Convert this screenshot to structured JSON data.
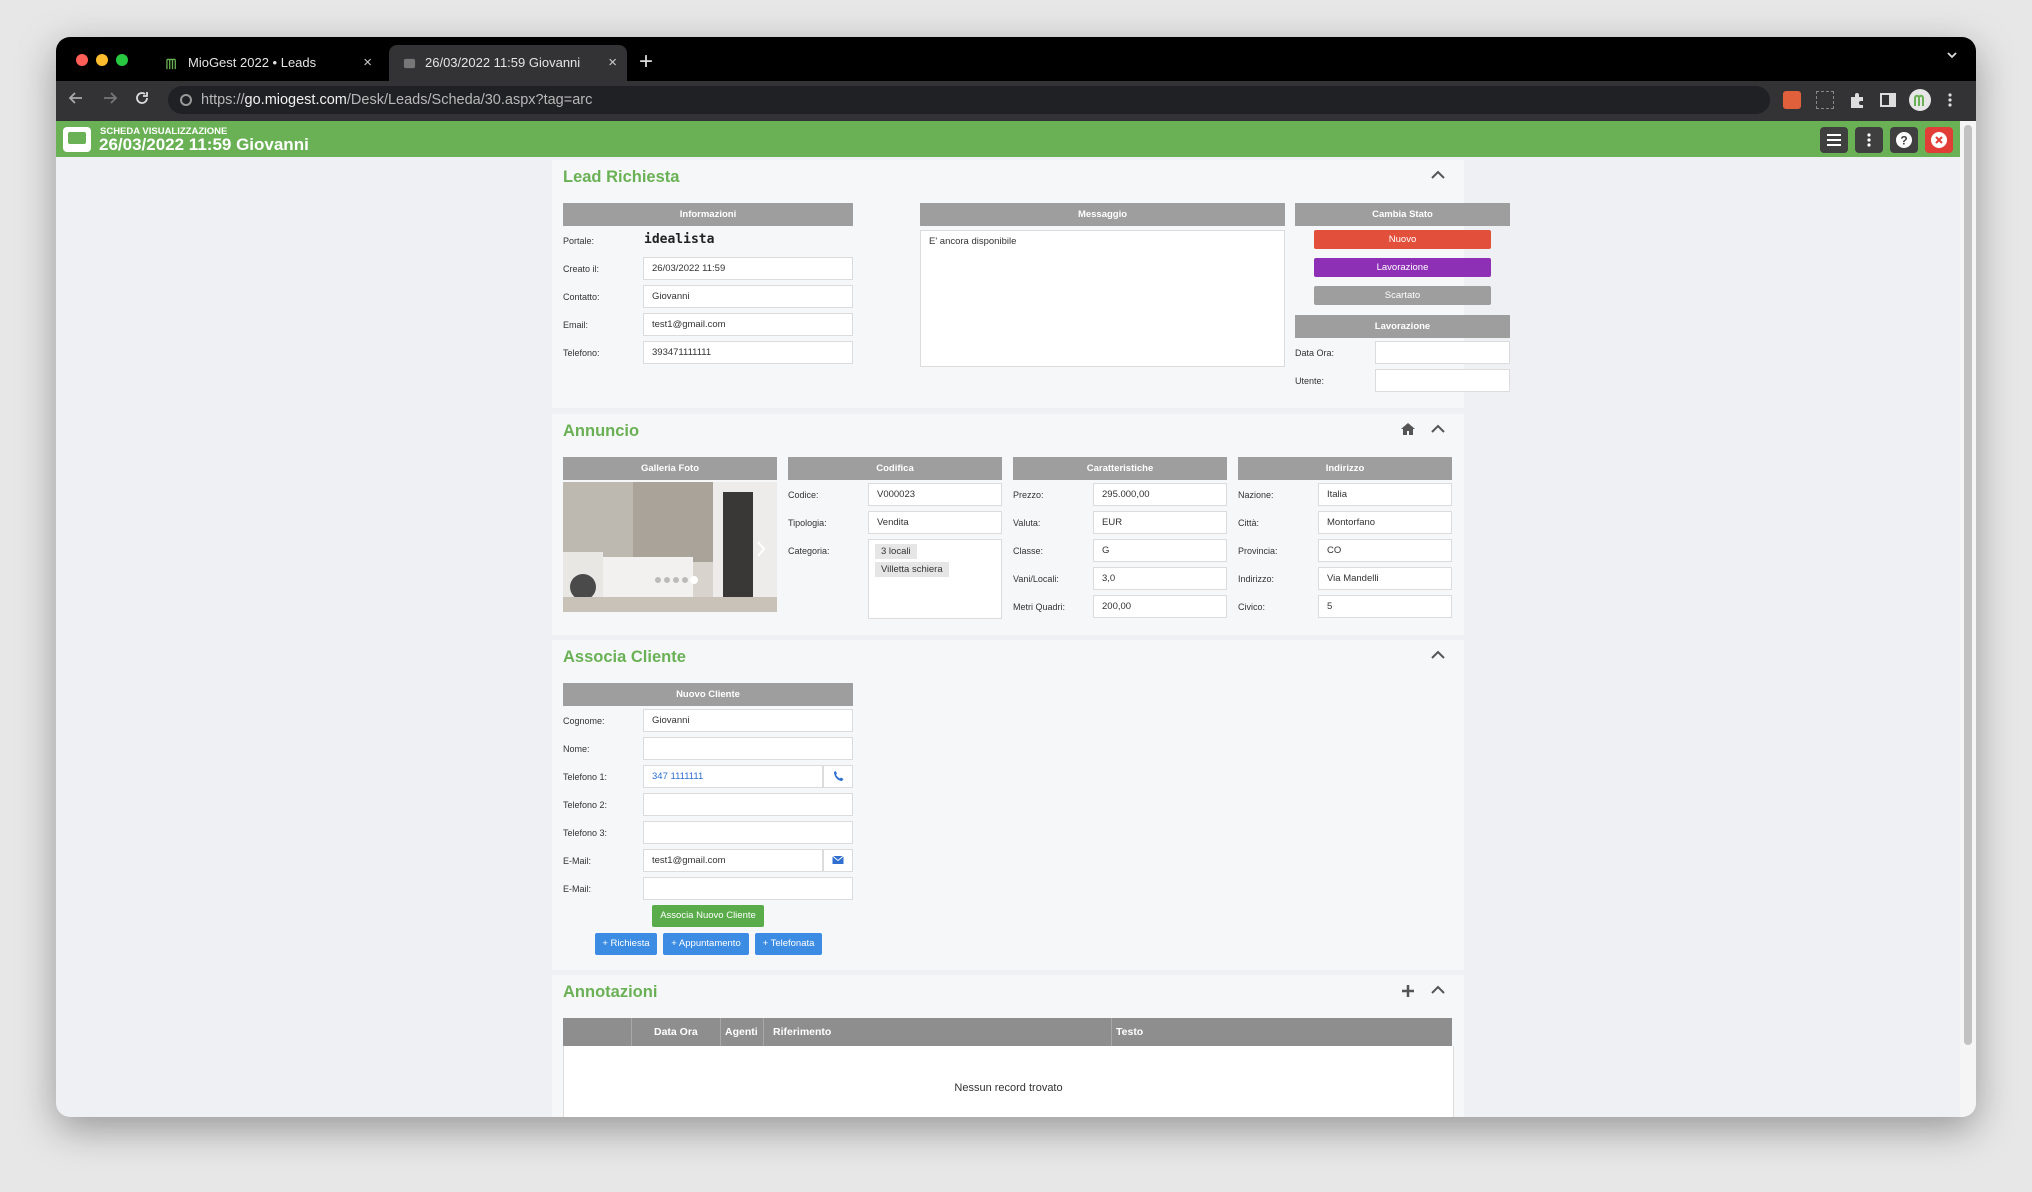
{
  "browser": {
    "tabs": [
      {
        "label": "MioGest 2022 • Leads",
        "close": "×"
      },
      {
        "label": "26/03/2022 11:59 Giovanni",
        "close": "×"
      }
    ],
    "new_tab": "+",
    "url_prefix": "https://",
    "url_host": "go.miogest.com",
    "url_path": "/Desk/Leads/Scheda/30.aspx?tag=arc",
    "colors": {
      "close": "#ff5f57",
      "minimize": "#febc2e",
      "zoom": "#28c840"
    }
  },
  "header": {
    "subtitle": "SCHEDA VISUALIZZAZIONE",
    "title": "26/03/2022 11:59 Giovanni",
    "accent": "#6ab155"
  },
  "lead": {
    "title": "Lead Richiesta",
    "info_header": "Informazioni",
    "message_header": "Messaggio",
    "state_header": "Cambia Stato",
    "work_header": "Lavorazione",
    "labels": {
      "portale": "Portale:",
      "creato": "Creato il:",
      "contatto": "Contatto:",
      "email": "Email:",
      "telefono": "Telefono:",
      "data_ora": "Data Ora:",
      "utente": "Utente:"
    },
    "portal_name": "idealista",
    "created": "26/03/2022 11:59",
    "contact": "Giovanni",
    "email": "test1@gmail.com",
    "phone": "393471111111",
    "message": "E' ancora disponibile",
    "states": [
      {
        "label": "Nuovo",
        "color": "#e2503c"
      },
      {
        "label": "Lavorazione",
        "color": "#8e30b6"
      },
      {
        "label": "Scartato",
        "color": "#9e9e9e"
      }
    ],
    "work_date": "",
    "work_user": ""
  },
  "annuncio": {
    "title": "Annuncio",
    "headers": {
      "gallery": "Galleria Foto",
      "codifica": "Codifica",
      "caratteristiche": "Caratteristiche",
      "indirizzo": "Indirizzo"
    },
    "labels": {
      "codice": "Codice:",
      "tipologia": "Tipologia:",
      "categoria": "Categoria:",
      "prezzo": "Prezzo:",
      "valuta": "Valuta:",
      "classe": "Classe:",
      "vani": "Vani/Locali:",
      "mq": "Metri Quadri:",
      "nazione": "Nazione:",
      "citta": "Città:",
      "provincia": "Provincia:",
      "indirizzo": "Indirizzo:",
      "civico": "Civico:"
    },
    "codice": "V000023",
    "tipologia": "Vendita",
    "categorie": [
      "3 locali",
      "Villetta schiera"
    ],
    "prezzo": "295.000,00",
    "valuta": "EUR",
    "classe": "G",
    "vani": "3,0",
    "mq": "200,00",
    "nazione": "Italia",
    "citta": "Montorfano",
    "provincia": "CO",
    "indirizzo": "Via Mandelli",
    "civico": "5"
  },
  "cliente": {
    "title": "Associa Cliente",
    "header": "Nuovo Cliente",
    "labels": {
      "cognome": "Cognome:",
      "nome": "Nome:",
      "tel1": "Telefono 1:",
      "tel2": "Telefono 2:",
      "tel3": "Telefono 3:",
      "email1": "E-Mail:",
      "email2": "E-Mail:"
    },
    "cognome": "Giovanni",
    "nome": "",
    "tel1": "347 1111111",
    "tel2": "",
    "tel3": "",
    "email1": "test1@gmail.com",
    "email2": "",
    "associa_button": "Associa Nuovo Cliente",
    "action_buttons": [
      "+ Richiesta",
      "+ Appuntamento",
      "+ Telefonata"
    ]
  },
  "annotazioni": {
    "title": "Annotazioni",
    "columns": [
      "",
      "Data Ora",
      "Agenti",
      "Riferimento",
      "Testo"
    ],
    "empty_message": "Nessun record trovato"
  }
}
